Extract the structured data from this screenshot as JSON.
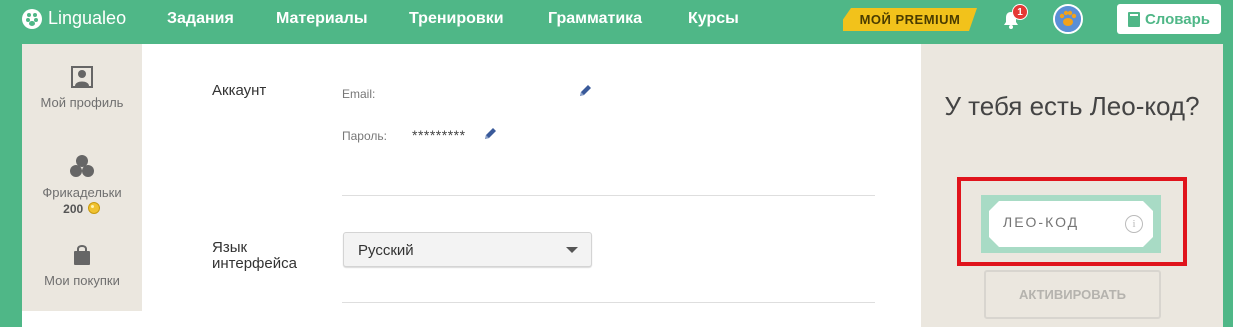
{
  "app": {
    "logo_text": "Lingualeo"
  },
  "nav": {
    "items": [
      {
        "label": "Задания"
      },
      {
        "label": "Материалы"
      },
      {
        "label": "Тренировки"
      },
      {
        "label": "Грамматика"
      },
      {
        "label": "Курсы"
      }
    ],
    "premium_label": "МОЙ PREMIUM",
    "notifications_count": "1",
    "dictionary_label": "Словарь"
  },
  "sidebar": {
    "items": [
      {
        "label": "Мой профиль",
        "icon": "profile-icon"
      },
      {
        "label": "Фрикадельки",
        "value": "200",
        "icon": "meatballs-icon"
      },
      {
        "label": "Мои покупки",
        "icon": "bag-icon"
      }
    ]
  },
  "account": {
    "title": "Аккаунт",
    "email_label": "Email:",
    "email_value": "",
    "password_label": "Пароль:",
    "password_value": "*********"
  },
  "language": {
    "title": "Язык интерфейса",
    "selected": "Русский"
  },
  "leo_code": {
    "title": "У тебя есть Лео-код?",
    "placeholder": "ЛЕО-КОД",
    "activate_label": "АКТИВИРОВАТЬ"
  },
  "colors": {
    "brand_green": "#4fb787",
    "premium_yellow": "#f2c21b",
    "highlight_red": "#e0141c",
    "panel_beige": "#ebe7df"
  }
}
